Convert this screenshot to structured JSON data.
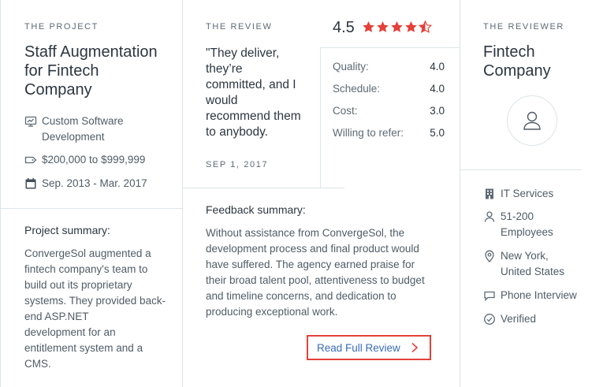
{
  "project": {
    "eyebrow": "THE PROJECT",
    "title_line1": "Staff Augmentation",
    "title_line2": "for Fintech",
    "title_line3": "Company",
    "service_line1": "Custom Software",
    "service_line2": "Development",
    "budget": "$200,000 to $999,999",
    "dates": "Sep. 2013 - Mar. 2017",
    "summary_label": "Project summary:",
    "summary_lines": [
      "ConvergeSol augmented a",
      "fintech company's team to",
      "build out its proprietary",
      "systems. They provided back-",
      "end ASP.NET",
      "development for an",
      "entitlement system and a",
      "CMS."
    ],
    "icons": {
      "service": "monitor-chart-icon",
      "budget": "price-tag-icon",
      "dates": "calendar-icon"
    }
  },
  "review": {
    "eyebrow": "THE REVIEW",
    "quote_lines": [
      "\"They deliver,",
      "they’re",
      "committed, and I",
      "would",
      "recommend them",
      "to anybody."
    ],
    "date": "SEP 1, 2017",
    "overall_rating": "4.5",
    "star_rating_value": 4.5,
    "star_rating_max": 5,
    "star_color": "#e4413a",
    "scores": [
      {
        "label": "Quality:",
        "value": "4.0"
      },
      {
        "label": "Schedule:",
        "value": "4.0"
      },
      {
        "label": "Cost:",
        "value": "3.0"
      },
      {
        "label": "Willing to refer:",
        "value": "5.0"
      }
    ],
    "feedback_label": "Feedback summary:",
    "feedback_lines": [
      "Without assistance from ConvergeSol, the",
      "development process and final product would",
      "have suffered. The agency earned praise for",
      "their broad talent pool, attentiveness to budget",
      "and timeline concerns, and dedication to",
      "producing exceptional work."
    ],
    "button_label": "Read Full Review",
    "button_border_color": "#e4413a",
    "link_color": "#3a6dbb"
  },
  "reviewer": {
    "eyebrow": "THE REVIEWER",
    "name_line1": "Fintech",
    "name_line2": "Company",
    "avatar_icon": "user-icon",
    "industry": "IT Services",
    "size_line1": "51-200",
    "size_line2": "Employees",
    "location_line1": "New York,",
    "location_line2": "United States",
    "method": "Phone Interview",
    "status": "Verified",
    "icons": {
      "industry": "building-icon",
      "size": "person-icon",
      "location": "map-pin-icon",
      "method": "speech-bubble-icon",
      "status": "check-circle-icon"
    }
  }
}
